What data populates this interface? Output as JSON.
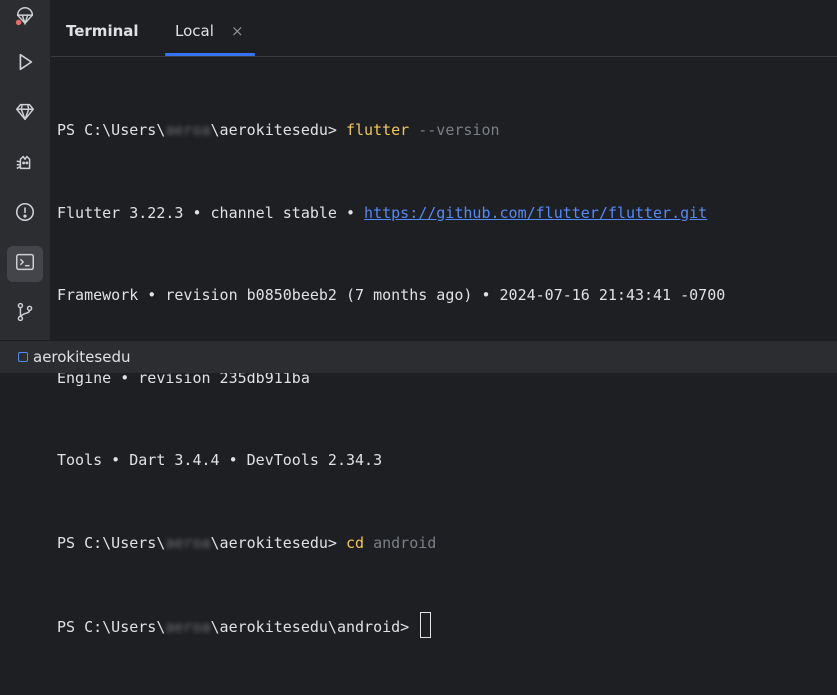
{
  "tabs": {
    "title": "Terminal",
    "local_label": "Local",
    "close_glyph": "×"
  },
  "sidebar": {
    "items": [
      {
        "icon": "parachute-icon"
      },
      {
        "icon": "run-icon"
      },
      {
        "icon": "gem-icon"
      },
      {
        "icon": "cat-icon"
      },
      {
        "icon": "problems-icon"
      },
      {
        "icon": "terminal-icon",
        "active": true
      },
      {
        "icon": "git-branch-icon"
      }
    ]
  },
  "terminal": {
    "line1": {
      "prompt_pre": "PS C:\\Users\\",
      "user": "aeroa",
      "prompt_post": "\\aerokitesedu> ",
      "cmd": "flutter",
      "args": " --version"
    },
    "line2": {
      "text": "Flutter 3.22.3 • channel stable • ",
      "link": "https://github.com/flutter/flutter.git"
    },
    "line3": "Framework • revision b0850beeb2 (7 months ago) • 2024-07-16 21:43:41 -0700",
    "line4": "Engine • revision 235db911ba",
    "line5": "Tools • Dart 3.4.4 • DevTools 2.34.3",
    "line6": {
      "prompt_pre": "PS C:\\Users\\",
      "user": "aeroa",
      "prompt_post": "\\aerokitesedu> ",
      "cmd": "cd",
      "args": " android"
    },
    "line7": {
      "prompt_pre": "PS C:\\Users\\",
      "user": "aeroa",
      "prompt_post": "\\aerokitesedu\\android> "
    }
  },
  "status": {
    "project": "aerokitesedu"
  },
  "colors": {
    "accent": "#3574f0",
    "command": "#f2c55c",
    "link": "#548af7"
  }
}
